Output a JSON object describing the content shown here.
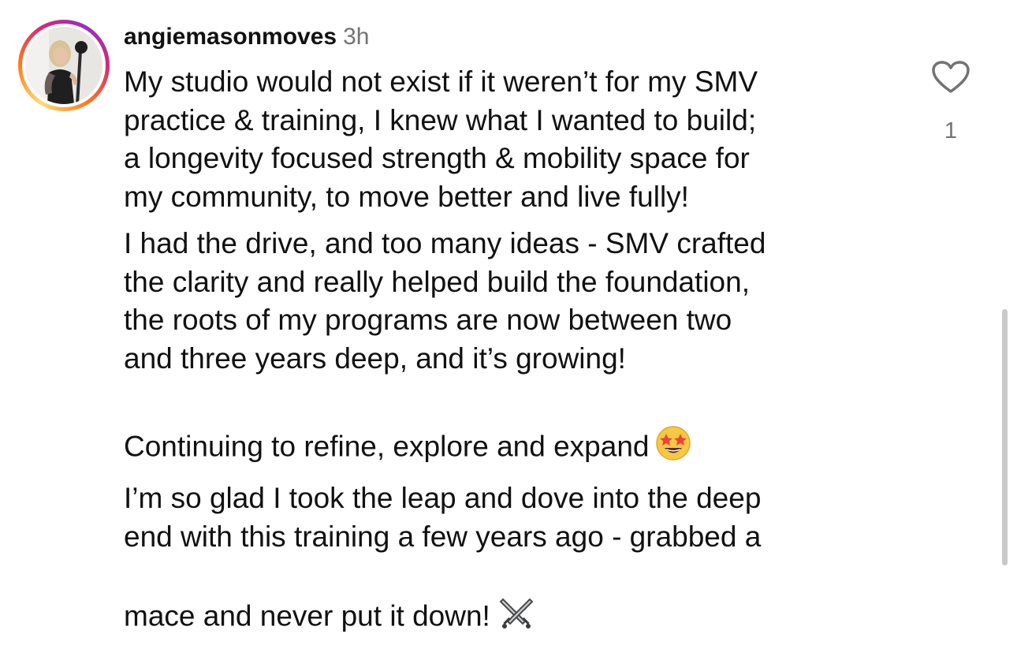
{
  "comment": {
    "username": "angiemasonmoves",
    "timestamp": "3h",
    "paragraphs": [
      "My studio would not exist if it weren’t for my SMV\npractice & training, I knew what I wanted to build;\na longevity focused strength & mobility space for\nmy community, to move better and live fully!",
      "I had the drive, and too many ideas - SMV crafted\nthe clarity and really helped build the foundation,\nthe roots of my programs are now between two\nand three years deep, and it’s growing!",
      "Continuing to refine, explore and expand",
      "I’m so glad I took the leap and dove into the deep\nend with this training a few years ago - grabbed a\nmace and never put it down!"
    ],
    "emojis": [
      "star-struck-emoji",
      "crossed-swords-emoji"
    ],
    "like_count": "1"
  },
  "icons": {
    "like": "heart-outline-icon",
    "avatar_ring": "story-ring"
  },
  "colors": {
    "text": "#111111",
    "secondary": "#737373",
    "ring_yellow": "#feda75",
    "ring_orange": "#fa7e1e",
    "ring_pink": "#d62976",
    "ring_purple": "#962fbf"
  }
}
